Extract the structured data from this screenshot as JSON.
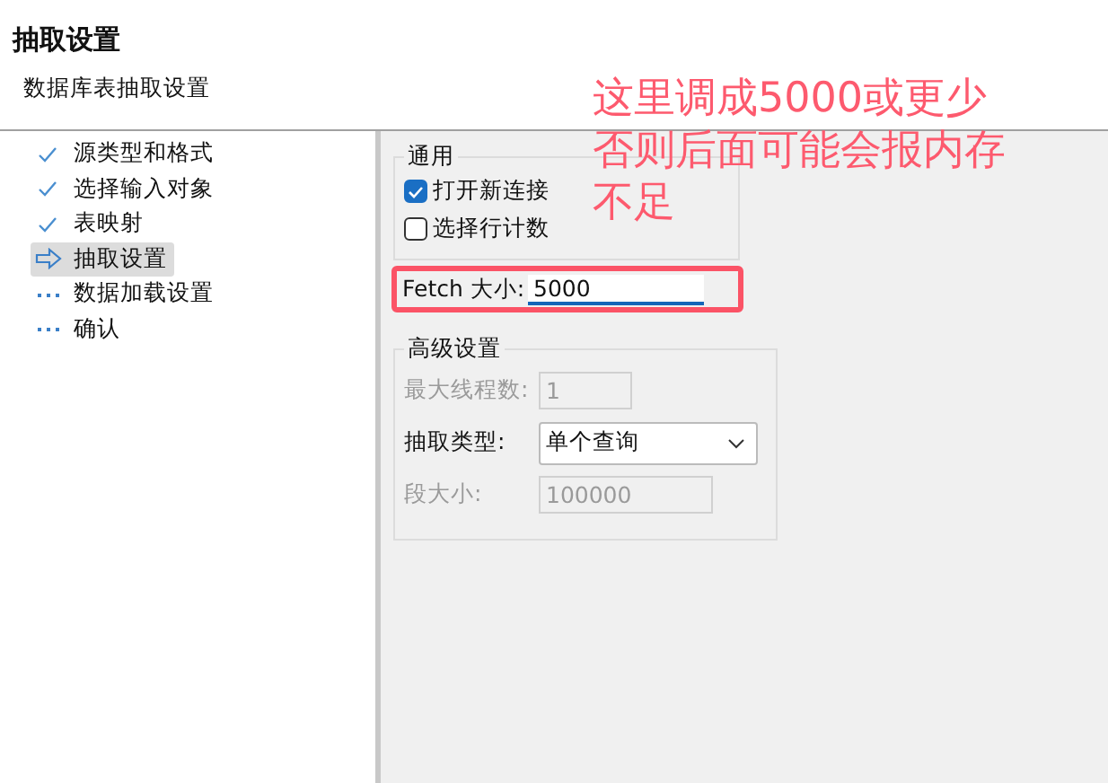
{
  "header": {
    "title": "抽取设置",
    "subtitle": "数据库表抽取设置"
  },
  "steps": [
    {
      "label": "源类型和格式",
      "kind": "done",
      "selected": false
    },
    {
      "label": "选择输入对象",
      "kind": "done",
      "selected": false
    },
    {
      "label": "表映射",
      "kind": "done",
      "selected": false
    },
    {
      "label": "抽取设置",
      "kind": "current",
      "selected": true
    },
    {
      "label": "数据加载设置",
      "kind": "pending",
      "selected": false
    },
    {
      "label": "确认",
      "kind": "pending",
      "selected": false
    }
  ],
  "general": {
    "title": "通用",
    "options": [
      {
        "label": "打开新连接",
        "checked": true
      },
      {
        "label": "选择行计数",
        "checked": false
      }
    ]
  },
  "fetch": {
    "label": "Fetch 大小:",
    "value": "5000",
    "highlighted": true
  },
  "advanced": {
    "title": "高级设置",
    "fields": [
      {
        "label": "最大线程数:",
        "value": "1",
        "kind": "text",
        "disabled": true
      },
      {
        "label": "抽取类型:",
        "value": "单个查询",
        "kind": "select",
        "disabled": false
      },
      {
        "label": "段大小:",
        "value": "100000",
        "kind": "text",
        "disabled": true
      }
    ]
  },
  "annotation": {
    "lines": [
      "这里调成5000或更少",
      "否则后面可能会报内存",
      "不足"
    ]
  }
}
